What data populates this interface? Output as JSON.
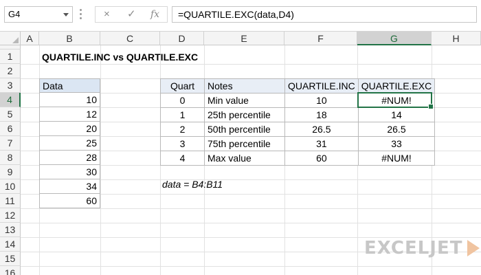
{
  "formula_bar": {
    "name_box": "G4",
    "cancel_icon": "×",
    "enter_icon": "✓",
    "fx_icon": "fx",
    "formula": "=QUARTILE.EXC(data,D4)"
  },
  "columns": [
    "A",
    "B",
    "C",
    "D",
    "E",
    "F",
    "G",
    "H"
  ],
  "rows": [
    "1",
    "2",
    "3",
    "4",
    "5",
    "6",
    "7",
    "8",
    "9",
    "10",
    "11",
    "12",
    "13",
    "14",
    "15",
    "16"
  ],
  "selected": {
    "column": "G",
    "row": "4"
  },
  "sheet": {
    "title": "QUARTILE.INC vs QUARTILE.EXC",
    "data_header": "Data",
    "data_values": [
      "10",
      "12",
      "20",
      "25",
      "28",
      "30",
      "34",
      "60"
    ],
    "table": {
      "headers": [
        "Quart",
        "Notes",
        "QUARTILE.INC",
        "QUARTILE.EXC"
      ],
      "rows": [
        [
          "0",
          "Min value",
          "10",
          "#NUM!"
        ],
        [
          "1",
          "25th percentile",
          "18",
          "14"
        ],
        [
          "2",
          "50th percentile",
          "26.5",
          "26.5"
        ],
        [
          "3",
          "75th percentile",
          "31",
          "33"
        ],
        [
          "4",
          "Max value",
          "60",
          "#NUM!"
        ]
      ]
    },
    "note": "data = B4:B11"
  },
  "logo": {
    "text": "EXCELJET"
  }
}
